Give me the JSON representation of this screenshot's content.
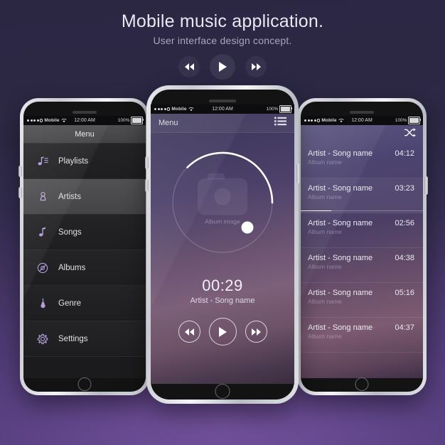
{
  "heading": {
    "title": "Mobile music application.",
    "subtitle": "User interface design concept."
  },
  "top_controls": [
    {
      "name": "rewind",
      "icon": "rewind-icon",
      "label": "Rewind"
    },
    {
      "name": "play",
      "icon": "play-icon",
      "label": "Play"
    },
    {
      "name": "forward",
      "icon": "fast-forward-icon",
      "label": "Fast forward"
    }
  ],
  "status_bar": {
    "carrier": "Mobile",
    "time": "12:00 AM",
    "battery": "100%",
    "signal_dots_filled": 4,
    "signal_dots_total": 5,
    "wifi_icon": "wifi-icon"
  },
  "left_phone": {
    "header_title": "Menu",
    "items": [
      {
        "label": "Playlists",
        "icon": "music-note-list-icon",
        "active": false
      },
      {
        "label": "Artists",
        "icon": "artist-person-icon",
        "active": true
      },
      {
        "label": "Songs",
        "icon": "music-note-icon",
        "active": false
      },
      {
        "label": "Albums",
        "icon": "vinyl-record-icon",
        "active": false
      },
      {
        "label": "Genre",
        "icon": "guitar-icon",
        "active": false
      },
      {
        "label": "Settings",
        "icon": "gear-icon",
        "active": false
      }
    ]
  },
  "center_phone": {
    "header": {
      "menu_label": "Menu",
      "list_icon": "list-menu-icon"
    },
    "album": {
      "placeholder_label": "Album image",
      "placeholder_icon": "camera-icon"
    },
    "progress_percent": 37,
    "elapsed_time": "00:29",
    "song_title": "Artist - Song name",
    "controls": [
      {
        "name": "rewind",
        "icon": "rewind-icon",
        "label": "Rewind"
      },
      {
        "name": "play",
        "icon": "play-icon",
        "label": "Play"
      },
      {
        "name": "forward",
        "icon": "fast-forward-icon",
        "label": "Fast forward"
      }
    ]
  },
  "right_phone": {
    "header": {
      "shuffle_icon": "shuffle-icon"
    },
    "tracks": [
      {
        "title": "Artist - Song name",
        "subtitle": "Album name",
        "duration": "04:12",
        "current": false,
        "progress_percent": 0
      },
      {
        "title": "Artist - Song name",
        "subtitle": "Album name",
        "duration": "03:23",
        "current": true,
        "progress_percent": 25
      },
      {
        "title": "Artist - Song name",
        "subtitle": "Album name",
        "duration": "02:56",
        "current": false,
        "progress_percent": 0
      },
      {
        "title": "Artist - Song name",
        "subtitle": "Album name",
        "duration": "04:38",
        "current": false,
        "progress_percent": 0
      },
      {
        "title": "Artist - Song name",
        "subtitle": "Album name",
        "duration": "05:16",
        "current": false,
        "progress_percent": 0
      },
      {
        "title": "Artist - Song name",
        "subtitle": "Album name",
        "duration": "04:37",
        "current": false,
        "progress_percent": 0
      }
    ]
  },
  "colors": {
    "background_top": "#2b2743",
    "background_bottom": "#513d78",
    "accent_lavender": "#b39ddb",
    "text_primary": "#e9e8f2",
    "text_secondary": "#a9a6bd"
  }
}
